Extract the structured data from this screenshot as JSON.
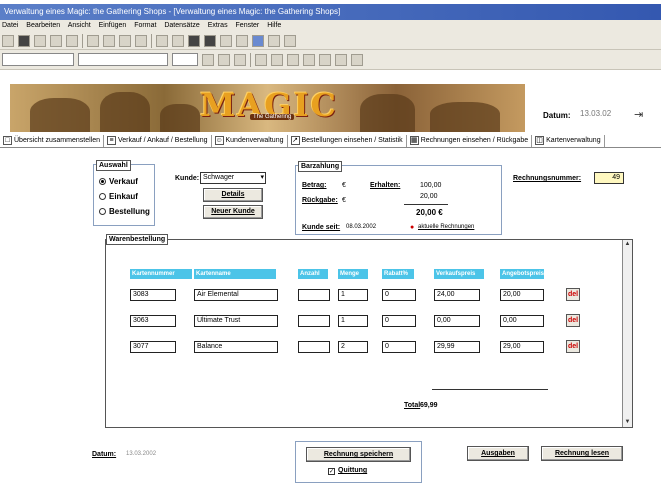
{
  "window": {
    "title": "Verwaltung eines Magic: the Gathering Shops - [Verwaltung eines Magic: the Gathering Shops]"
  },
  "menu": [
    "Datei",
    "Bearbeiten",
    "Ansicht",
    "Einfügen",
    "Format",
    "Datensätze",
    "Extras",
    "Fenster",
    "Hilfe"
  ],
  "banner": {
    "logo": "MAGIC",
    "logo_sub": "The Gathering"
  },
  "header": {
    "datum_label": "Datum:",
    "datum_value": "13.03.02"
  },
  "tabs": [
    "Übersicht zusammenstellen",
    "Verkauf / Ankauf / Bestellung",
    "Kundenverwaltung",
    "Bestellungen einsehen / Statistik",
    "Rechnungen einsehen / Rückgabe",
    "Kartenverwaltung"
  ],
  "auswahl": {
    "title": "Auswahl",
    "options": [
      "Verkauf",
      "Einkauf",
      "Bestellung"
    ],
    "selected": 0
  },
  "kunde": {
    "label": "Kunde:",
    "value": "Schwager",
    "details_button": "Details",
    "new_button": "Neuer Kunde"
  },
  "zahlung": {
    "title": "Barzahlung",
    "betrag_label": "Betrag:",
    "betrag_cur": "€",
    "erhalten_label": "Erhalten:",
    "erhalten_amount": "100,00",
    "rueckgabe_label": "Rückgabe:",
    "rueckgabe_cur": "€",
    "line_amount": "20,00",
    "sum_amount": "20,00 €",
    "kunde_seit_label": "Kunde seit:",
    "kunde_seit_value": "08.03.2002",
    "aktuelle_label": "aktuelle Rechnungen"
  },
  "rechnungsnummer": {
    "label": "Rechnungsnummer:",
    "value": "49"
  },
  "waren": {
    "title": "Warenbestellung",
    "columns": [
      "Kartennummer",
      "Kartenname",
      "Anzahl",
      "Menge",
      "Rabatt%",
      "Verkaufspreis",
      "Angebotspreis"
    ],
    "rows": [
      [
        "3083",
        "Air Elemental",
        "",
        "1",
        "0",
        "24,00",
        "20,00"
      ],
      [
        "3063",
        "Ultimate Trust",
        "",
        "1",
        "0",
        "0,00",
        "0,00"
      ],
      [
        "3077",
        "Balance",
        "",
        "2",
        "0",
        "29,99",
        "29,00"
      ]
    ],
    "delete_label": "del"
  },
  "total": {
    "label": "Total",
    "value": "69,99"
  },
  "footer": {
    "datum_label": "Datum:",
    "datum_value": "13.03.2002",
    "save_button": "Rechnung speichern",
    "print_label": "Quittung",
    "ausgaben_button": "Ausgaben",
    "rechnung_button": "Rechnung lesen"
  }
}
